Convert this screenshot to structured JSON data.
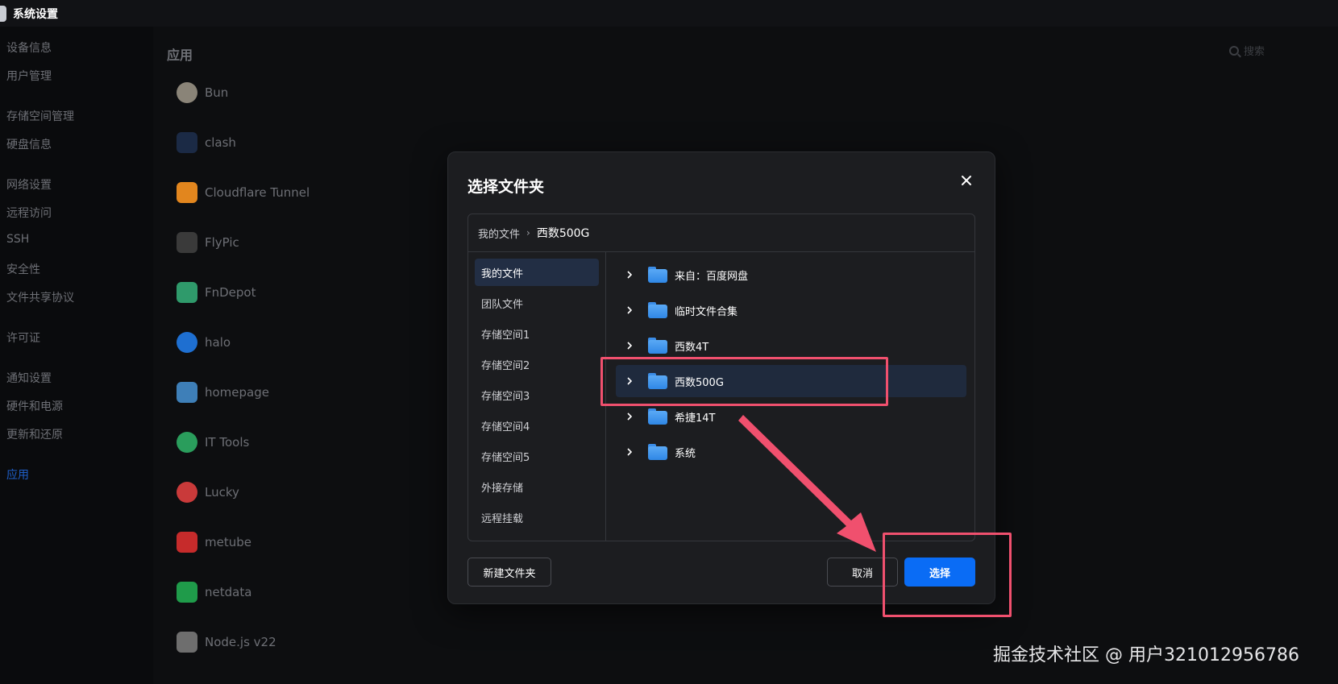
{
  "window": {
    "title": "系统设置"
  },
  "sidebar": {
    "items": [
      {
        "label": "设备信息",
        "active": false
      },
      {
        "label": "用户管理",
        "active": false
      },
      {
        "label": "存储空间管理",
        "active": false
      },
      {
        "label": "硬盘信息",
        "active": false
      },
      {
        "label": "网络设置",
        "active": false
      },
      {
        "label": "远程访问",
        "active": false
      },
      {
        "label": "SSH",
        "active": false
      },
      {
        "label": "安全性",
        "active": false
      },
      {
        "label": "文件共享协议",
        "active": false
      },
      {
        "label": "许可证",
        "active": false
      },
      {
        "label": "通知设置",
        "active": false
      },
      {
        "label": "硬件和电源",
        "active": false
      },
      {
        "label": "更新和还原",
        "active": false
      },
      {
        "label": "应用",
        "active": true
      }
    ]
  },
  "main": {
    "title": "应用",
    "search_placeholder": "搜索",
    "apps": [
      {
        "name": "Bun",
        "color": "#8a8478"
      },
      {
        "name": "clash",
        "color": "#1b2a45"
      },
      {
        "name": "Cloudflare Tunnel",
        "color": "#e2861e"
      },
      {
        "name": "FlyPic",
        "color": "#3a3a3a"
      },
      {
        "name": "FnDepot",
        "color": "#2f9a6b"
      },
      {
        "name": "halo",
        "color": "#1e6fd1"
      },
      {
        "name": "homepage",
        "color": "#3e7fb8"
      },
      {
        "name": "IT Tools",
        "color": "#2a9d5c"
      },
      {
        "name": "Lucky",
        "color": "#c93a3a"
      },
      {
        "name": "metube",
        "color": "#c62b2b"
      },
      {
        "name": "netdata",
        "color": "#1f9b4a"
      },
      {
        "name": "Node.js v22",
        "color": "#6e6e6e"
      }
    ]
  },
  "dialog": {
    "title": "选择文件夹",
    "breadcrumb": {
      "root": "我的文件",
      "separator": "›",
      "current": "西数500G"
    },
    "locations": [
      {
        "label": "我的文件",
        "active": true
      },
      {
        "label": "团队文件",
        "active": false
      },
      {
        "label": "存储空间1",
        "active": false
      },
      {
        "label": "存储空间2",
        "active": false
      },
      {
        "label": "存储空间3",
        "active": false
      },
      {
        "label": "存储空间4",
        "active": false
      },
      {
        "label": "存储空间5",
        "active": false
      },
      {
        "label": "外接存储",
        "active": false
      },
      {
        "label": "远程挂载",
        "active": false
      }
    ],
    "folders": [
      {
        "name": "来自：百度网盘",
        "selected": false
      },
      {
        "name": "临时文件合集",
        "selected": false
      },
      {
        "name": "西数4T",
        "selected": false
      },
      {
        "name": "西数500G",
        "selected": true
      },
      {
        "name": "希捷14T",
        "selected": false
      },
      {
        "name": "系统",
        "selected": false
      }
    ],
    "new_folder_label": "新建文件夹",
    "cancel_label": "取消",
    "select_label": "选择"
  },
  "watermark": "掘金技术社区 @ 用户321012956786",
  "colors": {
    "accent": "#0a6cf5",
    "annotation": "#f0506e",
    "selected_row": "#1f2a3d"
  }
}
